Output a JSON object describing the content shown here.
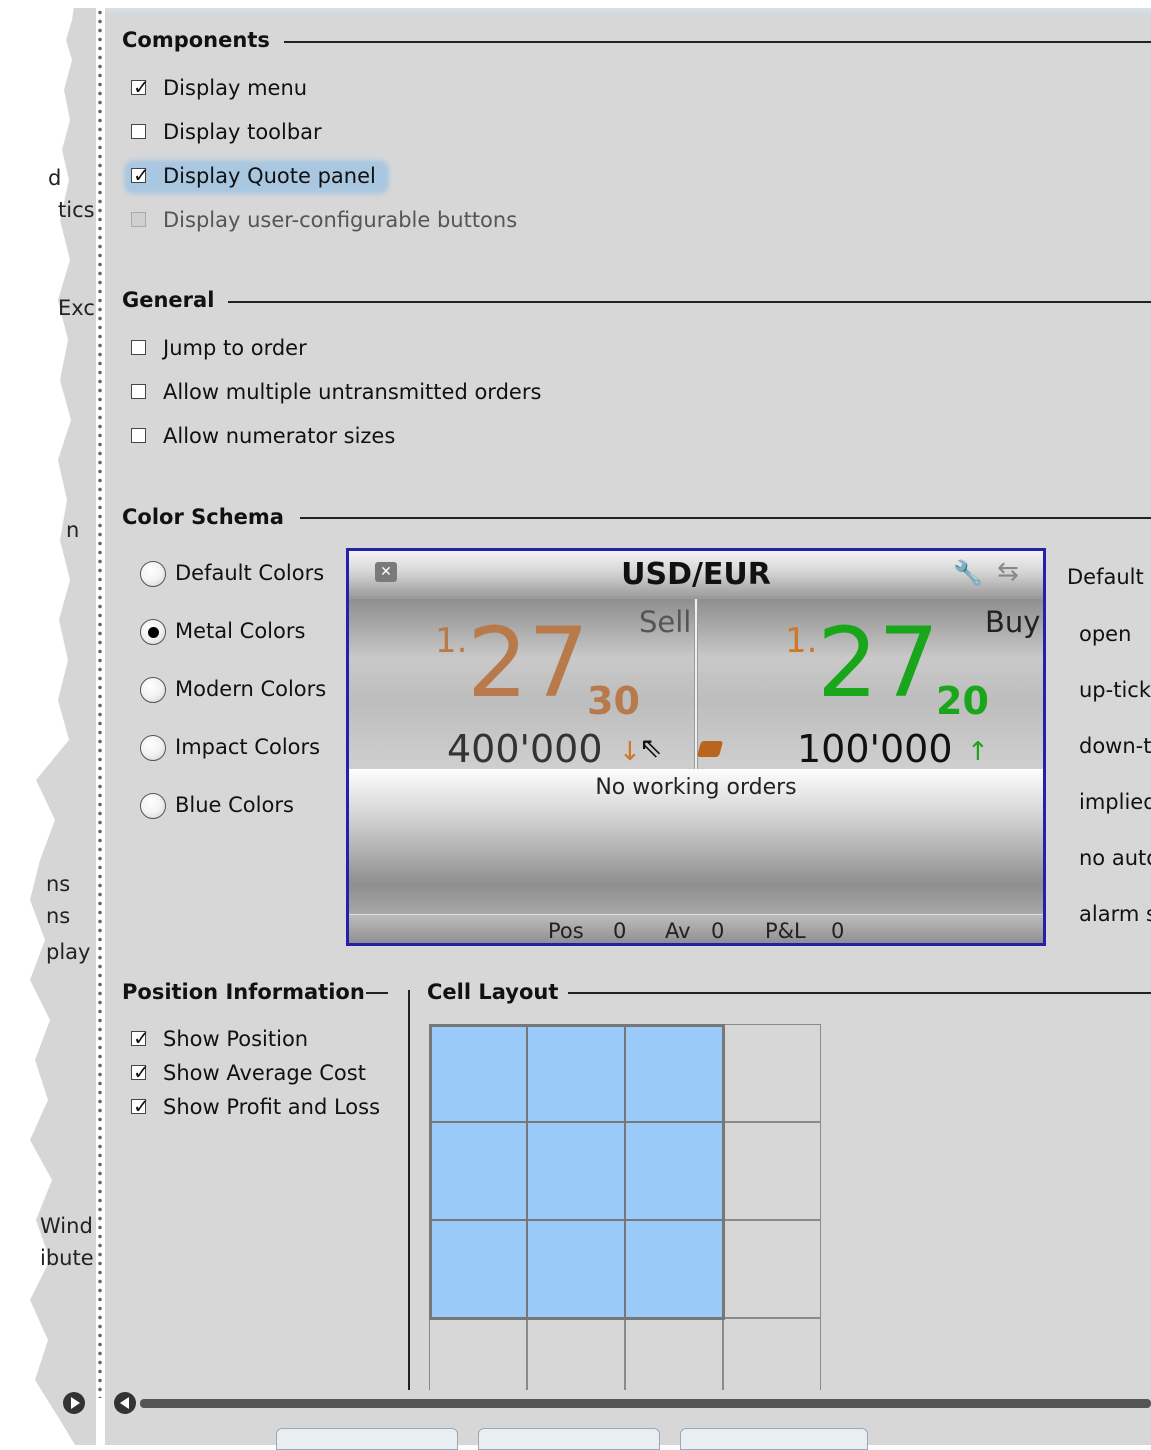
{
  "left_fragments": [
    "d",
    "tics",
    "Exc",
    "n",
    "ns",
    "ns",
    "play",
    "Wind",
    "ibute"
  ],
  "components": {
    "title": "Components",
    "items": [
      {
        "label": "Display menu",
        "checked": true,
        "disabled": false
      },
      {
        "label": "Display toolbar",
        "checked": false,
        "disabled": false
      },
      {
        "label": "Display Quote panel",
        "checked": true,
        "disabled": false,
        "focused": true
      },
      {
        "label": "Display user-configurable buttons",
        "checked": false,
        "disabled": true
      }
    ]
  },
  "general": {
    "title": "General",
    "items": [
      {
        "label": "Jump to order",
        "checked": false
      },
      {
        "label": "Allow multiple untransmitted orders",
        "checked": false
      },
      {
        "label": "Allow numerator sizes",
        "checked": false
      }
    ]
  },
  "color_schema": {
    "title": "Color Schema",
    "options": [
      {
        "label": "Default Colors",
        "selected": false
      },
      {
        "label": "Metal Colors",
        "selected": true
      },
      {
        "label": "Modern Colors",
        "selected": false
      },
      {
        "label": "Impact Colors",
        "selected": false
      },
      {
        "label": "Blue Colors",
        "selected": false
      }
    ],
    "legend": [
      "Default",
      "open",
      "up-tick",
      "down-t",
      "implied",
      "no auto",
      "alarm s"
    ]
  },
  "quote_panel": {
    "symbol": "USD/EUR",
    "sell_label": "Sell",
    "buy_label": "Buy",
    "sell": {
      "prefix": "1.",
      "big": "27",
      "small": "30",
      "size": "400'000",
      "arrow": "↓"
    },
    "buy": {
      "prefix": "1.",
      "big": "27",
      "small": "20",
      "size": "100'000",
      "arrow": "↑"
    },
    "no_orders": "No working orders",
    "pos_label": "Pos",
    "pos_value": "0",
    "av_label": "Av",
    "av_value": "0",
    "pl_label": "P&L",
    "pl_value": "0",
    "colors": {
      "sell": "#b87a4a",
      "buy": "#1aa61a",
      "border": "#2222a8"
    }
  },
  "position_info": {
    "title": "Position Information",
    "items": [
      {
        "label": "Show Position",
        "checked": true
      },
      {
        "label": "Show Average Cost",
        "checked": true
      },
      {
        "label": "Show Profit and Loss",
        "checked": true
      }
    ]
  },
  "cell_layout": {
    "title": "Cell Layout",
    "selected_cols": 3,
    "selected_rows": 3
  }
}
